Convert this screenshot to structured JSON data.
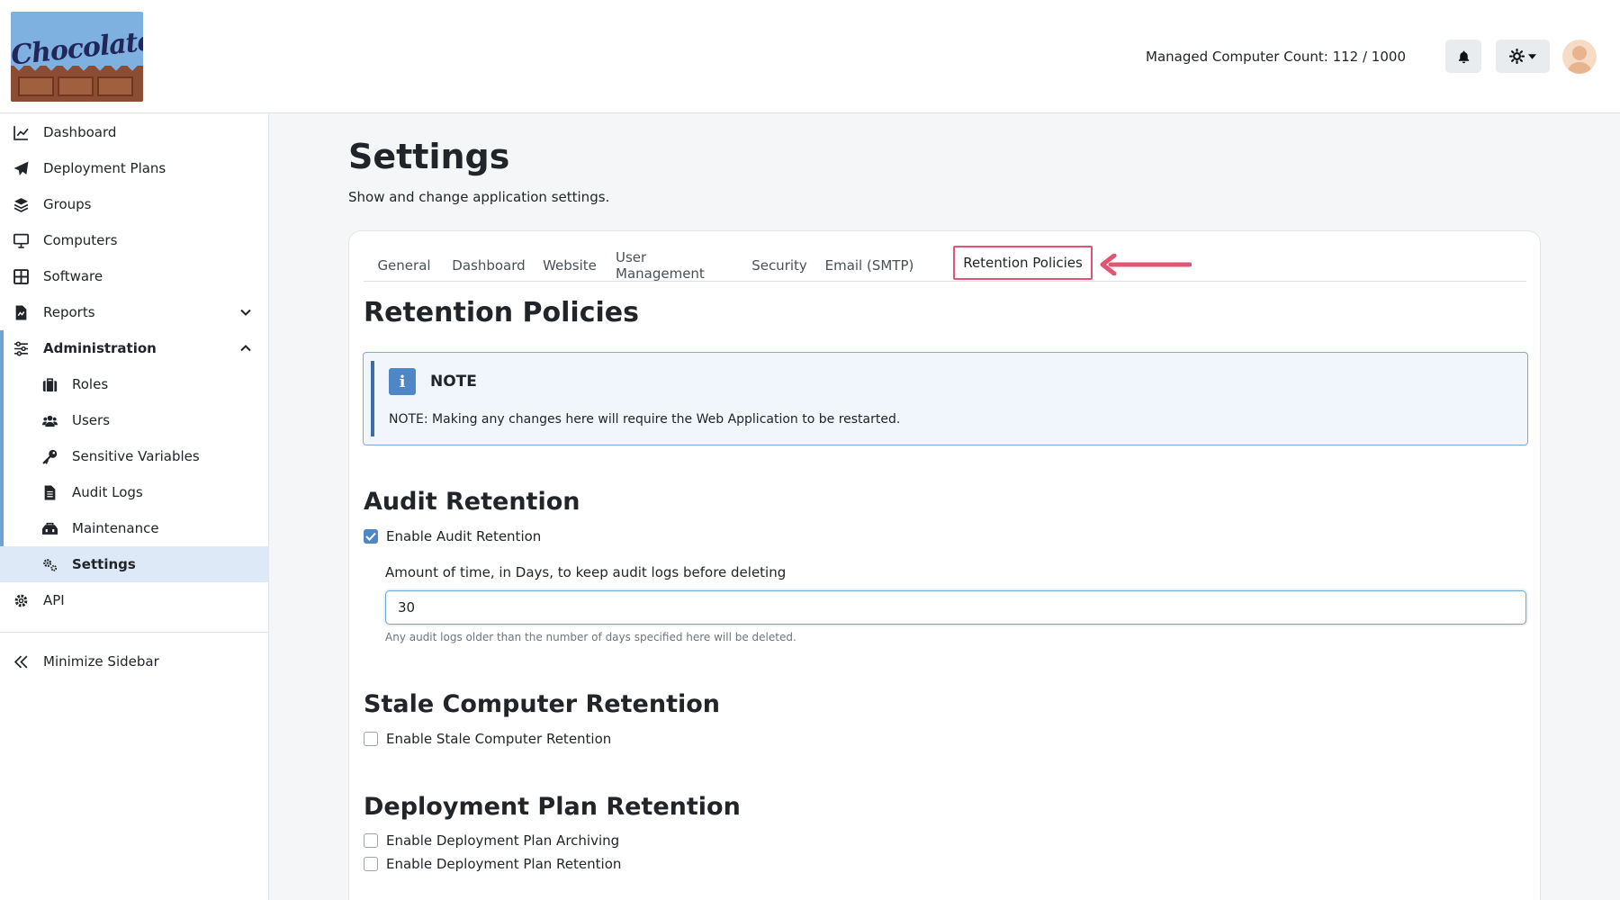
{
  "header": {
    "logo_text": "Chocolatey",
    "managed_count": "Managed Computer Count: 112 / 1000"
  },
  "sidebar": {
    "items": [
      {
        "label": "Dashboard",
        "icon": "chart-line-icon"
      },
      {
        "label": "Deployment Plans",
        "icon": "paper-plane-icon"
      },
      {
        "label": "Groups",
        "icon": "layers-icon"
      },
      {
        "label": "Computers",
        "icon": "desktop-icon"
      },
      {
        "label": "Software",
        "icon": "grid-icon"
      },
      {
        "label": "Reports",
        "icon": "report-file-icon"
      },
      {
        "label": "Administration",
        "icon": "sliders-icon"
      },
      {
        "label": "Roles",
        "icon": "briefcase-icon"
      },
      {
        "label": "Users",
        "icon": "users-icon"
      },
      {
        "label": "Sensitive Variables",
        "icon": "key-icon"
      },
      {
        "label": "Audit Logs",
        "icon": "file-text-icon"
      },
      {
        "label": "Maintenance",
        "icon": "toolbox-icon"
      },
      {
        "label": "Settings",
        "icon": "gears-icon"
      },
      {
        "label": "API",
        "icon": "gear-icon"
      }
    ],
    "minimize_label": "Minimize Sidebar"
  },
  "page": {
    "title": "Settings",
    "subtitle": "Show and change application settings."
  },
  "tabs": [
    {
      "label": "General"
    },
    {
      "label": "Dashboard"
    },
    {
      "label": "Website"
    },
    {
      "label": "User Management"
    },
    {
      "label": "Security"
    },
    {
      "label": "Email (SMTP)"
    },
    {
      "label": "Retention Policies"
    }
  ],
  "active_tab": "Retention Policies",
  "retention": {
    "title": "Retention Policies",
    "note": {
      "icon_letter": "i",
      "title": "NOTE",
      "text": "NOTE: Making any changes here will require the Web Application to be restarted."
    },
    "audit": {
      "title": "Audit Retention",
      "enable_label": "Enable Audit Retention",
      "enabled": true,
      "days_label": "Amount of time, in Days, to keep audit logs before deleting",
      "days_value": "30",
      "help": "Any audit logs older than the number of days specified here will be deleted."
    },
    "stale": {
      "title": "Stale Computer Retention",
      "enable_label": "Enable Stale Computer Retention",
      "enabled": false
    },
    "deployment": {
      "title": "Deployment Plan Retention",
      "archiving_label": "Enable Deployment Plan Archiving",
      "archiving_enabled": false,
      "retention_label": "Enable Deployment Plan Retention",
      "retention_enabled": false
    }
  },
  "colors": {
    "highlight_border": "#e35472",
    "accent": "#4f86c6",
    "active_nav_bg": "#dde9f6"
  }
}
